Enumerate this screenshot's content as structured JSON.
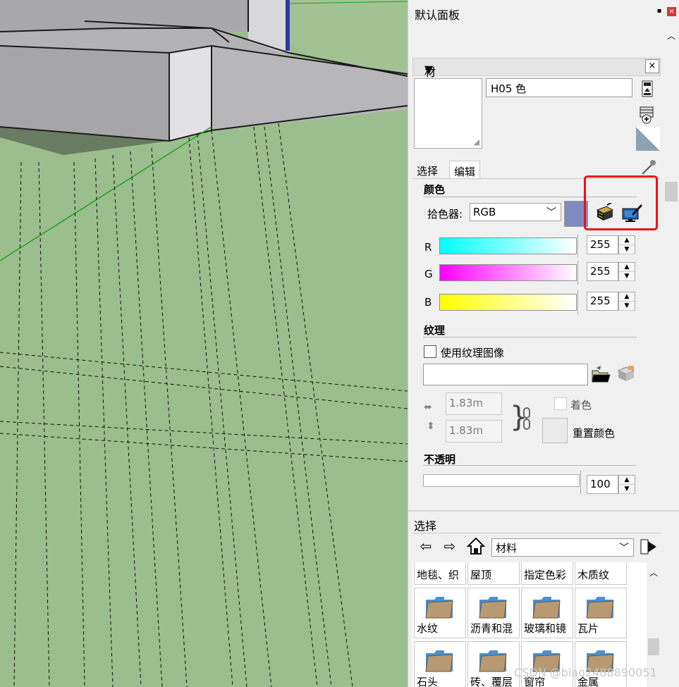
{
  "panel": {
    "title": "默认面板",
    "pin_glyph": "▪",
    "close_glyph": "×"
  },
  "materials": {
    "header": "材料",
    "collapse_arrow": "▼",
    "close_glyph": "×",
    "name": "H05 色",
    "tabs": [
      "选择",
      "编辑"
    ],
    "active_tab": "编辑",
    "color_section": {
      "label": "颜色",
      "picker_label": "拾色器:",
      "picker_value": "RGB",
      "swatch_color": "#7f8bbe",
      "channels": [
        {
          "label": "R",
          "value": "255",
          "gradient_start": "#00ffff"
        },
        {
          "label": "G",
          "value": "255",
          "gradient_start": "#ff00ff"
        },
        {
          "label": "B",
          "value": "255",
          "gradient_start": "#ffff00"
        }
      ]
    },
    "texture_section": {
      "label": "纹理",
      "use_texture_label": "使用纹理图像",
      "use_texture_checked": false,
      "path_value": "",
      "width": "1.83m",
      "height": "1.83m",
      "colorize_label": "着色",
      "reset_color_label": "重置颜色"
    },
    "opacity_section": {
      "label": "不透明",
      "value": "100"
    }
  },
  "browser": {
    "header": "选择",
    "collection": "材料",
    "items": [
      "地毯、织",
      "屋顶",
      "指定色彩",
      "木质纹",
      "水纹",
      "沥青和混",
      "玻璃和镜",
      "瓦片",
      "石头",
      "砖、覆层",
      "窗帘",
      "金属"
    ]
  },
  "watermark": "CSDN @biao2488890051",
  "colors": {
    "ground": "#9cbd8e",
    "highlight": "#ee1111",
    "swatch": "#7f8bbe"
  }
}
